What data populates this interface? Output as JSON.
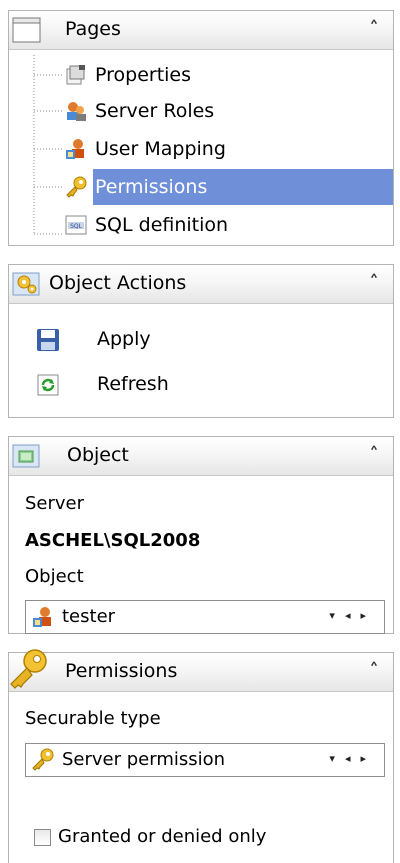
{
  "pages": {
    "title": "Pages",
    "items": [
      {
        "label": "Properties",
        "icon": "properties-icon"
      },
      {
        "label": "Server Roles",
        "icon": "server-roles-icon"
      },
      {
        "label": "User Mapping",
        "icon": "user-mapping-icon"
      },
      {
        "label": "Permissions",
        "icon": "key-icon"
      },
      {
        "label": "SQL definition",
        "icon": "sql-icon"
      }
    ],
    "selected_index": 3
  },
  "object_actions": {
    "title": "Object Actions",
    "apply_label": "Apply",
    "refresh_label": "Refresh"
  },
  "object_panel": {
    "title": "Object",
    "server_label": "Server",
    "server_value": "ASCHEL\\SQL2008",
    "object_label": "Object",
    "object_value": "tester"
  },
  "permissions_panel": {
    "title": "Permissions",
    "securable_label": "Securable type",
    "securable_value": "Server permission",
    "granted_only_label": "Granted or denied only",
    "granted_only_checked": false
  },
  "colors": {
    "selection": "#6f8fd8",
    "header_gradient_end": "#e6e6e6",
    "panel_border": "#b4b4b4"
  }
}
